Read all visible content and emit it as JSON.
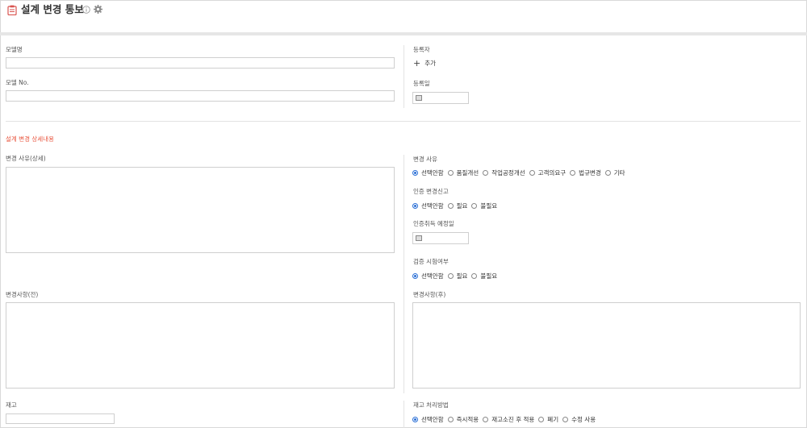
{
  "header": {
    "title": "설계 변경 통보"
  },
  "fields": {
    "model_name_label": "모델명",
    "model_no_label": "모델 No.",
    "registrant_label": "등록자",
    "add_label": "추가",
    "reg_date_label": "등록일"
  },
  "section": {
    "title": "설계 변경 상세내용"
  },
  "detail": {
    "change_reason_detail_label": "변경 사유(상세)",
    "change_reason_label": "변경 사유",
    "change_reason_options": [
      "선택안함",
      "품질개선",
      "작업공정개선",
      "고객의요구",
      "법규변경",
      "기타"
    ],
    "cert_report_label": "인증 변경신고",
    "cert_report_options": [
      "선택안함",
      "필요",
      "불필요"
    ],
    "cert_date_label": "인증취득 예정일",
    "verify_label": "검증 시험여부",
    "verify_options": [
      "선택안함",
      "필요",
      "불필요"
    ],
    "before_label": "변경사항(전)",
    "after_label": "변경사항(후)",
    "stock_label": "재고",
    "stock_method_label": "재고 처리방법",
    "stock_method_options": [
      "선택안함",
      "즉시적용",
      "재고소진 후 적용",
      "폐기",
      "수정 사용"
    ]
  }
}
